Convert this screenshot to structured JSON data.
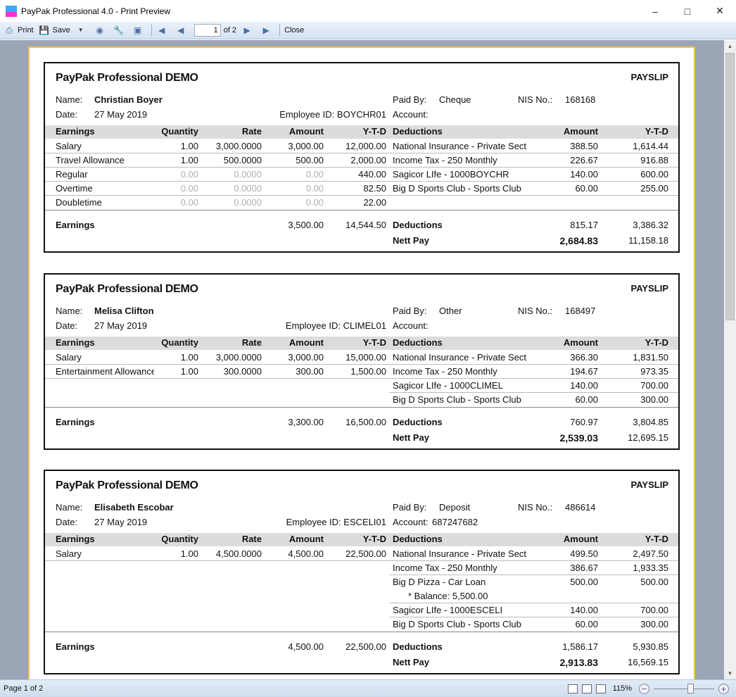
{
  "window": {
    "title": "PayPak Professional 4.0 - Print Preview",
    "controls": [
      "minimize",
      "maximize",
      "close"
    ]
  },
  "toolbar": {
    "print": "Print",
    "save": "Save",
    "page_value": "1",
    "page_of": "of 2",
    "close": "Close",
    "icons": [
      "printer-icon",
      "save-icon",
      "dropdown-icon",
      "binoculars-icon",
      "wrench-icon",
      "page-setup-icon",
      "first-page-icon",
      "prev-page-icon",
      "next-page-icon",
      "last-page-icon"
    ]
  },
  "status": {
    "page": "Page 1 of 2",
    "zoom": "115%",
    "zoom_slider_percent": 115
  },
  "colors": {
    "header_row": "#dcdcdc",
    "paper_border": "#f2c14e",
    "viewer_bg": "#9ba5b5",
    "zero_value": "#b0b0b0"
  },
  "labels": {
    "company": "PayPak Professional DEMO",
    "payslip": "PAYSLIP",
    "name": "Name:",
    "date": "Date:",
    "paid_by": "Paid By:",
    "nis": "NIS No.:",
    "employee_id": "Employee ID:",
    "account": "Account:",
    "earnings": "Earnings",
    "quantity": "Quantity",
    "rate": "Rate",
    "amount": "Amount",
    "ytd": "Y-T-D",
    "deductions": "Deductions",
    "nett_pay": "Nett Pay"
  },
  "slips": [
    {
      "name": "Christian Boyer",
      "date": "27 May 2019",
      "employee_id": "BOYCHR01",
      "paid_by": "Cheque",
      "nis": "168168",
      "account": "",
      "earnings": [
        {
          "name": "Salary",
          "qty": "1.00",
          "rate": "3,000.0000",
          "amount": "3,000.00",
          "ytd": "12,000.00",
          "zero": false
        },
        {
          "name": "Travel Allowance",
          "qty": "1.00",
          "rate": "500.0000",
          "amount": "500.00",
          "ytd": "2,000.00",
          "zero": false
        },
        {
          "name": "Regular",
          "qty": "0.00",
          "rate": "0.0000",
          "amount": "0.00",
          "ytd": "440.00",
          "zero": true
        },
        {
          "name": "Overtime",
          "qty": "0.00",
          "rate": "0.0000",
          "amount": "0.00",
          "ytd": "82.50",
          "zero": true
        },
        {
          "name": "Doubletime",
          "qty": "0.00",
          "rate": "0.0000",
          "amount": "0.00",
          "ytd": "22.00",
          "zero": true
        }
      ],
      "deductions": [
        {
          "name": "National Insurance - Private Sect",
          "amount": "388.50",
          "ytd": "1,614.44"
        },
        {
          "name": "Income Tax - 250 Monthly",
          "amount": "226.67",
          "ytd": "916.88"
        },
        {
          "name": "Sagicor LIfe - 1000BOYCHR",
          "amount": "140.00",
          "ytd": "600.00"
        },
        {
          "name": "Big D Sports Club - Sports Club",
          "amount": "60.00",
          "ytd": "255.00"
        }
      ],
      "totals": {
        "earn_amount": "3,500.00",
        "earn_ytd": "14,544.50",
        "ded_amount": "815.17",
        "ded_ytd": "3,386.32",
        "nett_amount": "2,684.83",
        "nett_ytd": "11,158.18"
      }
    },
    {
      "name": "Melisa Clifton",
      "date": "27 May 2019",
      "employee_id": "CLIMEL01",
      "paid_by": "Other",
      "nis": "168497",
      "account": "",
      "earnings": [
        {
          "name": "Salary",
          "qty": "1.00",
          "rate": "3,000.0000",
          "amount": "3,000.00",
          "ytd": "15,000.00",
          "zero": false
        },
        {
          "name": "Entertainment Allowance",
          "qty": "1.00",
          "rate": "300.0000",
          "amount": "300.00",
          "ytd": "1,500.00",
          "zero": false
        }
      ],
      "deductions": [
        {
          "name": "National Insurance - Private Sect",
          "amount": "366.30",
          "ytd": "1,831.50"
        },
        {
          "name": "Income Tax - 250 Monthly",
          "amount": "194.67",
          "ytd": "973.35"
        },
        {
          "name": "Sagicor LIfe - 1000CLIMEL",
          "amount": "140.00",
          "ytd": "700.00"
        },
        {
          "name": "Big D Sports Club - Sports Club",
          "amount": "60.00",
          "ytd": "300.00"
        }
      ],
      "totals": {
        "earn_amount": "3,300.00",
        "earn_ytd": "16,500.00",
        "ded_amount": "760.97",
        "ded_ytd": "3,804.85",
        "nett_amount": "2,539.03",
        "nett_ytd": "12,695.15"
      }
    },
    {
      "name": "Elisabeth Escobar",
      "date": "27 May 2019",
      "employee_id": "ESCELI01",
      "paid_by": "Deposit",
      "nis": "486614",
      "account": "687247682",
      "earnings": [
        {
          "name": "Salary",
          "qty": "1.00",
          "rate": "4,500.0000",
          "amount": "4,500.00",
          "ytd": "22,500.00",
          "zero": false
        }
      ],
      "deductions": [
        {
          "name": "National Insurance - Private Sect",
          "amount": "499.50",
          "ytd": "2,497.50"
        },
        {
          "name": "Income Tax - 250 Monthly",
          "amount": "386.67",
          "ytd": "1,933.35"
        },
        {
          "name": "Big D Pizza - Car Loan",
          "amount": "500.00",
          "ytd": "500.00",
          "note": "* Balance: 5,500.00"
        },
        {
          "name": "Sagicor LIfe - 1000ESCELI",
          "amount": "140.00",
          "ytd": "700.00"
        },
        {
          "name": "Big D Sports Club - Sports Club",
          "amount": "60.00",
          "ytd": "300.00"
        }
      ],
      "totals": {
        "earn_amount": "4,500.00",
        "earn_ytd": "22,500.00",
        "ded_amount": "1,586.17",
        "ded_ytd": "5,930.85",
        "nett_amount": "2,913.83",
        "nett_ytd": "16,569.15"
      }
    }
  ]
}
